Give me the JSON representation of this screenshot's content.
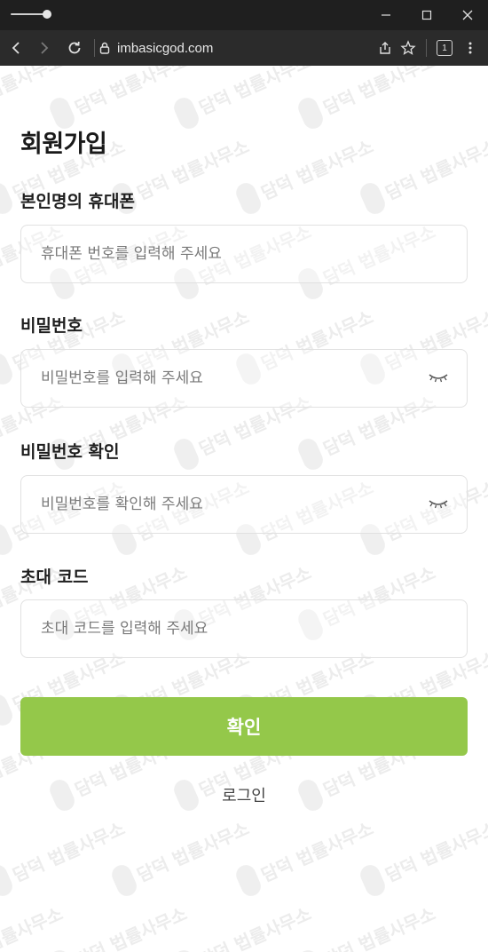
{
  "browser": {
    "url": "imbasicgod.com",
    "tab_count": "1"
  },
  "watermark": {
    "text": "담덕 법률사무소"
  },
  "form": {
    "title": "회원가입",
    "phone": {
      "label": "본인명의 휴대폰",
      "placeholder": "휴대폰 번호를 입력해 주세요"
    },
    "password": {
      "label": "비밀번호",
      "placeholder": "비밀번호를 입력해 주세요"
    },
    "password_confirm": {
      "label": "비밀번호 확인",
      "placeholder": "비밀번호를 확인해 주세요"
    },
    "invite_code": {
      "label": "초대 코드",
      "placeholder": "초대 코드를 입력해 주세요"
    },
    "submit_label": "확인",
    "login_label": "로그인"
  },
  "colors": {
    "accent": "#94c84a",
    "titlebar": "#1f1f1f",
    "toolbar": "#2b2b2b"
  },
  "icons": [
    "minimize-icon",
    "maximize-icon",
    "close-icon",
    "back-arrow-icon",
    "forward-arrow-icon",
    "reload-icon",
    "lock-icon",
    "share-icon",
    "bookmark-star-icon",
    "tab-count-icon",
    "more-menu-icon",
    "eye-closed-icon"
  ]
}
